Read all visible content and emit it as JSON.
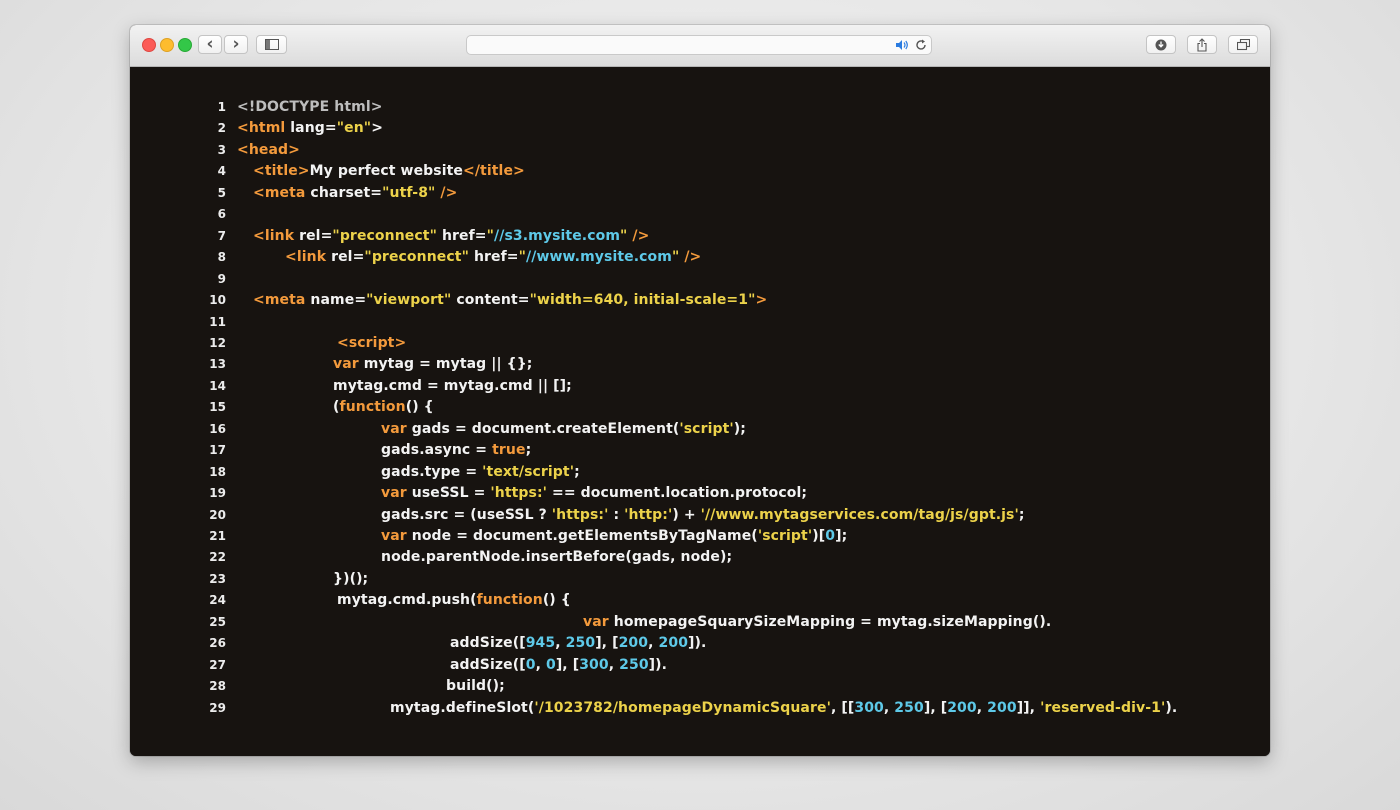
{
  "toolbar": {
    "back_glyph": "‹",
    "forward_glyph": "›",
    "address_value": "",
    "icons": [
      "sidebar-icon",
      "volume-icon",
      "reload-icon",
      "downloads-icon",
      "share-icon",
      "tabs-icon"
    ]
  },
  "colors": {
    "tag": "#f39a3c",
    "string": "#ecd24a",
    "url": "#5ec9e8",
    "keyword": "#f39a3c",
    "plain": "#f3f3f3",
    "background": "#171310"
  },
  "code": {
    "lines": [
      {
        "n": "1",
        "indent": 0,
        "tokens": [
          {
            "t": "<!DOCTYPE html>",
            "c": "dim"
          }
        ]
      },
      {
        "n": "2",
        "indent": 0,
        "tokens": [
          {
            "t": "<html",
            "c": "tag"
          },
          {
            "t": " lang=",
            "c": "plain"
          },
          {
            "t": "\"en\"",
            "c": "str"
          },
          {
            "t": ">",
            "c": "plain"
          }
        ]
      },
      {
        "n": "3",
        "indent": 0,
        "tokens": [
          {
            "t": "<head>",
            "c": "tag"
          }
        ]
      },
      {
        "n": "4",
        "indent": 16,
        "tokens": [
          {
            "t": "<title>",
            "c": "tag"
          },
          {
            "t": "My perfect website",
            "c": "plain"
          },
          {
            "t": "</title>",
            "c": "tag"
          }
        ]
      },
      {
        "n": "5",
        "indent": 16,
        "tokens": [
          {
            "t": "<meta",
            "c": "tag"
          },
          {
            "t": " charset=",
            "c": "plain"
          },
          {
            "t": "\"utf-8\"",
            "c": "str"
          },
          {
            "t": " />",
            "c": "tag"
          }
        ]
      },
      {
        "n": "6",
        "indent": 0,
        "tokens": []
      },
      {
        "n": "7",
        "indent": 16,
        "tokens": [
          {
            "t": "<link",
            "c": "tag"
          },
          {
            "t": " rel=",
            "c": "plain"
          },
          {
            "t": "\"preconnect\"",
            "c": "str"
          },
          {
            "t": " href=",
            "c": "plain"
          },
          {
            "t": "\"",
            "c": "str"
          },
          {
            "t": "//s3.mysite.com",
            "c": "url"
          },
          {
            "t": "\"",
            "c": "str"
          },
          {
            "t": " />",
            "c": "tag"
          }
        ]
      },
      {
        "n": "8",
        "indent": 48,
        "tokens": [
          {
            "t": "<link",
            "c": "tag"
          },
          {
            "t": " rel=",
            "c": "plain"
          },
          {
            "t": "\"preconnect\"",
            "c": "str"
          },
          {
            "t": " href=",
            "c": "plain"
          },
          {
            "t": "\"",
            "c": "str"
          },
          {
            "t": "//www.mysite.com",
            "c": "url"
          },
          {
            "t": "\"",
            "c": "str"
          },
          {
            "t": " />",
            "c": "tag"
          }
        ]
      },
      {
        "n": "9",
        "indent": 0,
        "tokens": []
      },
      {
        "n": "10",
        "indent": 16,
        "tokens": [
          {
            "t": "<meta",
            "c": "tag"
          },
          {
            "t": " name=",
            "c": "plain"
          },
          {
            "t": "\"viewport\"",
            "c": "str"
          },
          {
            "t": " content=",
            "c": "plain"
          },
          {
            "t": "\"width=640, initial-scale=1\"",
            "c": "str"
          },
          {
            "t": ">",
            "c": "tag"
          }
        ]
      },
      {
        "n": "11",
        "indent": 0,
        "tokens": []
      },
      {
        "n": "12",
        "indent": 100,
        "tokens": [
          {
            "t": "<script>",
            "c": "tag"
          }
        ]
      },
      {
        "n": "13",
        "indent": 96,
        "tokens": [
          {
            "t": "var",
            "c": "kw"
          },
          {
            "t": " mytag = mytag || {};",
            "c": "plain"
          }
        ]
      },
      {
        "n": "14",
        "indent": 96,
        "tokens": [
          {
            "t": "mytag.cmd = mytag.cmd || [];",
            "c": "plain"
          }
        ]
      },
      {
        "n": "15",
        "indent": 96,
        "tokens": [
          {
            "t": "(",
            "c": "plain"
          },
          {
            "t": "function",
            "c": "kw"
          },
          {
            "t": "() {",
            "c": "plain"
          }
        ]
      },
      {
        "n": "16",
        "indent": 144,
        "tokens": [
          {
            "t": "var",
            "c": "kw"
          },
          {
            "t": " gads = document.createElement(",
            "c": "plain"
          },
          {
            "t": "'script'",
            "c": "str"
          },
          {
            "t": ");",
            "c": "plain"
          }
        ]
      },
      {
        "n": "17",
        "indent": 144,
        "tokens": [
          {
            "t": "gads.async = ",
            "c": "plain"
          },
          {
            "t": "true",
            "c": "kw"
          },
          {
            "t": ";",
            "c": "plain"
          }
        ]
      },
      {
        "n": "18",
        "indent": 144,
        "tokens": [
          {
            "t": "gads.type = ",
            "c": "plain"
          },
          {
            "t": "'text/script'",
            "c": "str"
          },
          {
            "t": ";",
            "c": "plain"
          }
        ]
      },
      {
        "n": "19",
        "indent": 144,
        "tokens": [
          {
            "t": "var",
            "c": "kw"
          },
          {
            "t": " useSSL = ",
            "c": "plain"
          },
          {
            "t": "'https:'",
            "c": "str"
          },
          {
            "t": " == document.location.protocol;",
            "c": "plain"
          }
        ]
      },
      {
        "n": "20",
        "indent": 144,
        "tokens": [
          {
            "t": "gads.src = (useSSL ? ",
            "c": "plain"
          },
          {
            "t": "'https:'",
            "c": "str"
          },
          {
            "t": " : ",
            "c": "plain"
          },
          {
            "t": "'http:'",
            "c": "str"
          },
          {
            "t": ") + ",
            "c": "plain"
          },
          {
            "t": "'//www.mytagservices.com/tag/js/gpt.js'",
            "c": "str"
          },
          {
            "t": ";",
            "c": "plain"
          }
        ]
      },
      {
        "n": "21",
        "indent": 144,
        "tokens": [
          {
            "t": "var",
            "c": "kw"
          },
          {
            "t": " node = document.getElementsByTagName(",
            "c": "plain"
          },
          {
            "t": "'script'",
            "c": "str"
          },
          {
            "t": ")[",
            "c": "plain"
          },
          {
            "t": "0",
            "c": "num"
          },
          {
            "t": "];",
            "c": "plain"
          }
        ]
      },
      {
        "n": "22",
        "indent": 144,
        "tokens": [
          {
            "t": "node.parentNode.insertBefore(gads, node);",
            "c": "plain"
          }
        ]
      },
      {
        "n": "23",
        "indent": 96,
        "tokens": [
          {
            "t": "})();",
            "c": "plain"
          }
        ]
      },
      {
        "n": "24",
        "indent": 100,
        "tokens": [
          {
            "t": "mytag.cmd.push(",
            "c": "plain"
          },
          {
            "t": "function",
            "c": "kw"
          },
          {
            "t": "() {",
            "c": "plain"
          }
        ]
      },
      {
        "n": "25",
        "indent": 346,
        "tokens": [
          {
            "t": "var",
            "c": "kw"
          },
          {
            "t": " homepageSquarySizeMapping = mytag.sizeMapping().",
            "c": "plain"
          }
        ]
      },
      {
        "n": "26",
        "indent": 213,
        "tokens": [
          {
            "t": "addSize([",
            "c": "plain"
          },
          {
            "t": "945",
            "c": "num"
          },
          {
            "t": ", ",
            "c": "plain"
          },
          {
            "t": "250",
            "c": "num"
          },
          {
            "t": "], [",
            "c": "plain"
          },
          {
            "t": "200",
            "c": "num"
          },
          {
            "t": ", ",
            "c": "plain"
          },
          {
            "t": "200",
            "c": "num"
          },
          {
            "t": "]).",
            "c": "plain"
          }
        ]
      },
      {
        "n": "27",
        "indent": 213,
        "tokens": [
          {
            "t": "addSize([",
            "c": "plain"
          },
          {
            "t": "0",
            "c": "num"
          },
          {
            "t": ", ",
            "c": "plain"
          },
          {
            "t": "0",
            "c": "num"
          },
          {
            "t": "], [",
            "c": "plain"
          },
          {
            "t": "300",
            "c": "num"
          },
          {
            "t": ", ",
            "c": "plain"
          },
          {
            "t": "250",
            "c": "num"
          },
          {
            "t": "]).",
            "c": "plain"
          }
        ]
      },
      {
        "n": "28",
        "indent": 209,
        "tokens": [
          {
            "t": "build();",
            "c": "plain"
          }
        ]
      },
      {
        "n": "29",
        "indent": 153,
        "tokens": [
          {
            "t": "mytag.defineSlot(",
            "c": "plain"
          },
          {
            "t": "'/1023782/homepageDynamicSquare'",
            "c": "str"
          },
          {
            "t": ", [[",
            "c": "plain"
          },
          {
            "t": "300",
            "c": "num"
          },
          {
            "t": ", ",
            "c": "plain"
          },
          {
            "t": "250",
            "c": "num"
          },
          {
            "t": "], [",
            "c": "plain"
          },
          {
            "t": "200",
            "c": "num"
          },
          {
            "t": ", ",
            "c": "plain"
          },
          {
            "t": "200",
            "c": "num"
          },
          {
            "t": "]], ",
            "c": "plain"
          },
          {
            "t": "'reserved-div-1'",
            "c": "str"
          },
          {
            "t": ").",
            "c": "plain"
          }
        ]
      }
    ]
  }
}
